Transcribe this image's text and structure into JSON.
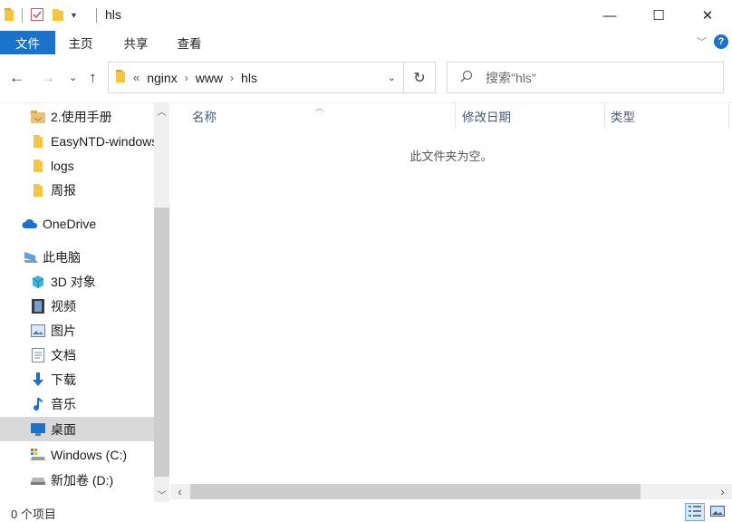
{
  "window": {
    "title": "hls",
    "minimize_glyph": "—",
    "maximize_glyph": "☐",
    "close_glyph": "✕"
  },
  "ribbon": {
    "tabs": [
      {
        "label": "文件"
      },
      {
        "label": "主页"
      },
      {
        "label": "共享"
      },
      {
        "label": "查看"
      }
    ],
    "help_glyph": "?"
  },
  "address": {
    "overflow": "«",
    "crumbs": [
      "nginx",
      "www",
      "hls"
    ]
  },
  "search": {
    "placeholder": "搜索\"hls\""
  },
  "navpane": {
    "items": [
      {
        "label": "2.使用手册",
        "icon": "folder-doc-icon"
      },
      {
        "label": "EasyNTD-windows",
        "icon": "folder-icon"
      },
      {
        "label": "logs",
        "icon": "folder-icon"
      },
      {
        "label": "周报",
        "icon": "folder-icon"
      },
      {
        "label": "OneDrive",
        "icon": "cloud-icon"
      },
      {
        "label": "此电脑",
        "icon": "computer-icon"
      },
      {
        "label": "3D 对象",
        "icon": "cube-icon"
      },
      {
        "label": "视频",
        "icon": "video-icon"
      },
      {
        "label": "图片",
        "icon": "pictures-icon"
      },
      {
        "label": "文档",
        "icon": "documents-icon"
      },
      {
        "label": "下载",
        "icon": "download-icon"
      },
      {
        "label": "音乐",
        "icon": "music-icon"
      },
      {
        "label": "桌面",
        "icon": "desktop-icon",
        "selected": true
      },
      {
        "label": "Windows (C:)",
        "icon": "drive-c-icon"
      },
      {
        "label": "新加卷 (D:)",
        "icon": "drive-d-icon"
      }
    ]
  },
  "columns": [
    "名称",
    "修改日期",
    "类型"
  ],
  "empty_message": "此文件夹为空。",
  "status": {
    "item_count": "0 个项目"
  },
  "colors": {
    "accent": "#1a73c8",
    "folder": "#f4c542",
    "selection": "#d9d9d9"
  }
}
